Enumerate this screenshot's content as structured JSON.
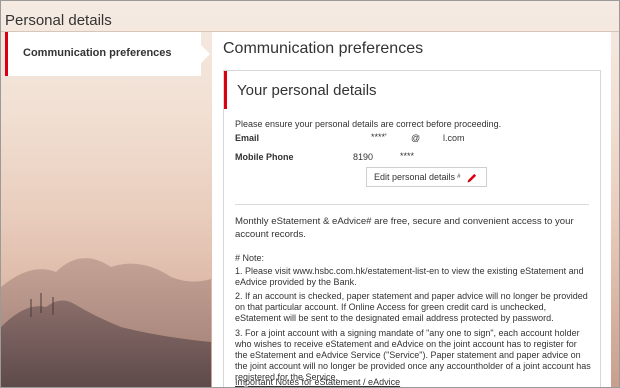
{
  "page": {
    "title": "Personal details"
  },
  "sidebar": {
    "active_item": "Communication preferences"
  },
  "main": {
    "heading": "Communication preferences"
  },
  "card": {
    "title": "Your personal details",
    "intro": "Please ensure your personal details are correct before proceeding.",
    "email": {
      "label": "Email",
      "masked_user": "****'",
      "at": "@",
      "domain": "l.com"
    },
    "mobile": {
      "label": "Mobile Phone",
      "prefix": "8190",
      "masked": "****"
    },
    "edit_button": {
      "label": "Edit personal details",
      "superscript": "#"
    },
    "statement": "Monthly eStatement & eAdvice# are free, secure and convenient access to your account records.",
    "note_heading": "# Note:",
    "notes": [
      "1. Please visit www.hsbc.com.hk/estatement-list-en to view the existing eStatement and eAdvice provided by the Bank.",
      "2. If an account is checked, paper statement and paper advice will no longer be provided on that particular account. If Online Access for green credit card is unchecked, eStatement will be sent to the designated email address protected by password.",
      "3. For a joint account with a signing mandate of \"any one to sign\", each account holder who wishes to receive eStatement and eAdvice on the joint account has to register for the eStatement and eAdvice Service (\"Service\"). Paper statement and paper advice on the joint account will no longer be provided once any accountholder of a joint account has registered for the Service."
    ],
    "important_link": "Important Notes for eStatement / eAdvice"
  },
  "colors": {
    "accent_red": "#db0011"
  },
  "icons": {
    "edit": "pencil-icon"
  }
}
